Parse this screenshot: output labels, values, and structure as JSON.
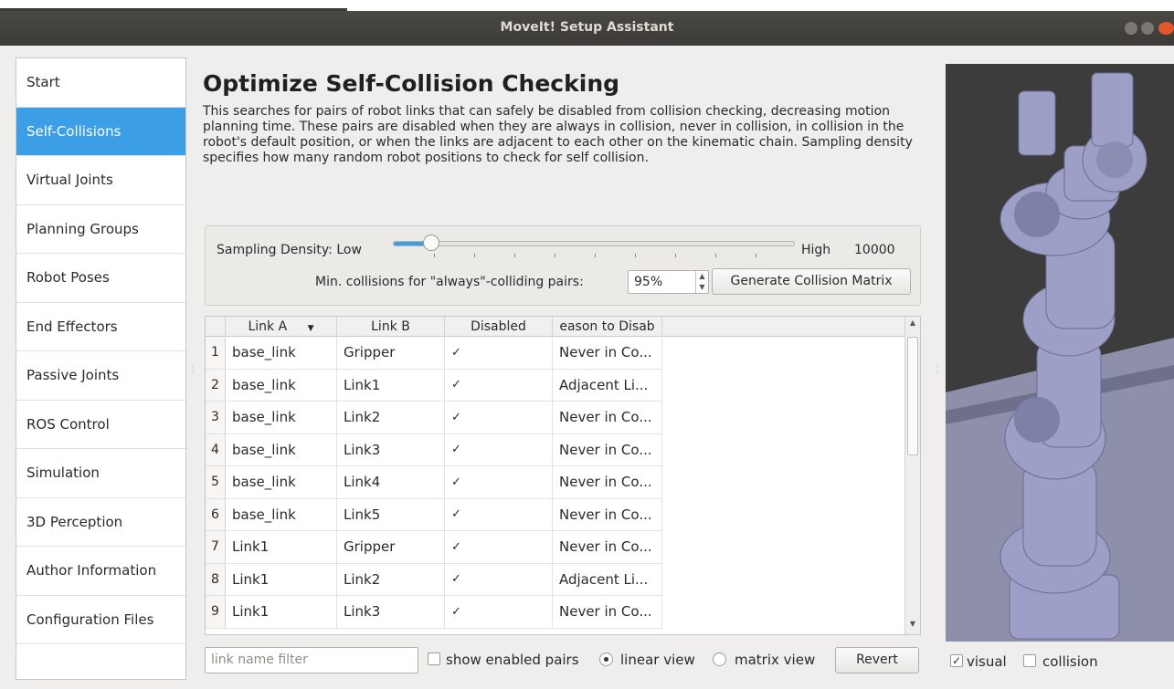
{
  "window": {
    "title": "MoveIt! Setup Assistant"
  },
  "sidebar": {
    "items": [
      {
        "label": "Start",
        "active": false
      },
      {
        "label": "Self-Collisions",
        "active": true
      },
      {
        "label": "Virtual Joints",
        "active": false
      },
      {
        "label": "Planning Groups",
        "active": false
      },
      {
        "label": "Robot Poses",
        "active": false
      },
      {
        "label": "End Effectors",
        "active": false
      },
      {
        "label": "Passive Joints",
        "active": false
      },
      {
        "label": "ROS Control",
        "active": false
      },
      {
        "label": "Simulation",
        "active": false
      },
      {
        "label": "3D Perception",
        "active": false
      },
      {
        "label": "Author Information",
        "active": false
      },
      {
        "label": "Configuration Files",
        "active": false
      }
    ]
  },
  "main": {
    "title": "Optimize Self-Collision Checking",
    "description": "This searches for pairs of robot links that can safely be disabled from collision checking, decreasing motion planning time. These pairs are disabled when they are always in collision, never in collision, in collision in the robot's default position, or when the links are adjacent to each other on the kinematic chain. Sampling density specifies how many random robot positions to check for self collision.",
    "sampling": {
      "label": "Sampling Density: Low",
      "high_label": "High",
      "value": "10000",
      "slider_fraction": 0.1
    },
    "min_collisions": {
      "label": "Min. collisions for \"always\"-colliding pairs:",
      "value": "95%"
    },
    "generate_button": "Generate Collision Matrix",
    "table": {
      "headers": [
        "Link A",
        "Link B",
        "Disabled",
        "eason to Disab"
      ],
      "rows": [
        {
          "n": "1",
          "a": "base_link",
          "b": "Gripper",
          "disabled": "✓",
          "reason": "Never in Co..."
        },
        {
          "n": "2",
          "a": "base_link",
          "b": "Link1",
          "disabled": "✓",
          "reason": "Adjacent Li..."
        },
        {
          "n": "3",
          "a": "base_link",
          "b": "Link2",
          "disabled": "✓",
          "reason": "Never in Co..."
        },
        {
          "n": "4",
          "a": "base_link",
          "b": "Link3",
          "disabled": "✓",
          "reason": "Never in Co..."
        },
        {
          "n": "5",
          "a": "base_link",
          "b": "Link4",
          "disabled": "✓",
          "reason": "Never in Co..."
        },
        {
          "n": "6",
          "a": "base_link",
          "b": "Link5",
          "disabled": "✓",
          "reason": "Never in Co..."
        },
        {
          "n": "7",
          "a": "Link1",
          "b": "Gripper",
          "disabled": "✓",
          "reason": "Never in Co..."
        },
        {
          "n": "8",
          "a": "Link1",
          "b": "Link2",
          "disabled": "✓",
          "reason": "Adjacent Li..."
        },
        {
          "n": "9",
          "a": "Link1",
          "b": "Link3",
          "disabled": "✓",
          "reason": "Never in Co..."
        }
      ]
    },
    "filter": {
      "placeholder": "link name filter"
    },
    "show_enabled_label": "show enabled pairs",
    "linear_view_label": "linear view",
    "matrix_view_label": "matrix view",
    "revert_label": "Revert"
  },
  "viewer": {
    "visual_label": "visual",
    "visual_checked": true,
    "collision_label": "collision",
    "collision_checked": false
  }
}
